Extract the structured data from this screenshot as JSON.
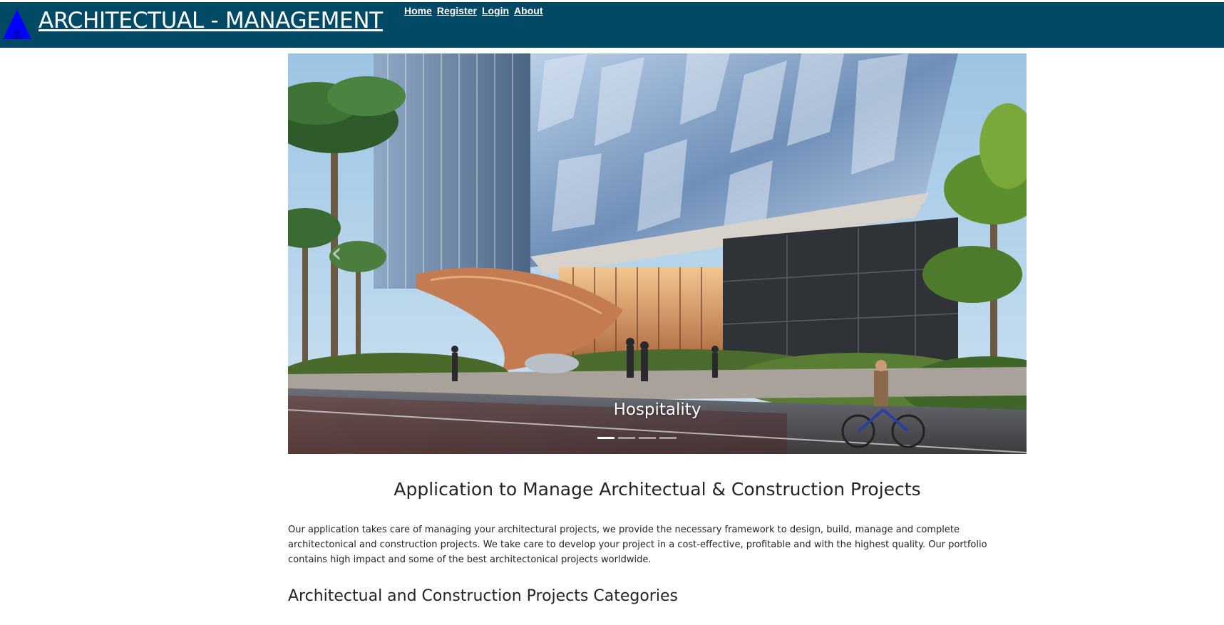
{
  "header": {
    "brand": "ARCHITECTUAL - MANAGEMENT",
    "nav": [
      {
        "label": "Home"
      },
      {
        "label": "Register"
      },
      {
        "label": "Login"
      },
      {
        "label": "About"
      }
    ],
    "bg_color": "#024966",
    "logo_color": "#0000ff"
  },
  "carousel": {
    "caption": "Hospitality",
    "prev_icon": "chevron-left-icon",
    "slide_count": 4,
    "active_slide": 1
  },
  "content": {
    "title": "Application to Manage Architectual & Construction Projects",
    "intro": "Our application takes care of managing your architectural projects, we provide the necessary framework to design, build, manage and complete architectonical and construction projects. We take care to develop your project in a cost-effective, profitable and with the highest quality. Our portfolio contains high impact and some of the best architectonical projects worldwide.",
    "categories_title": "Architectual and Construction Projects Categories"
  }
}
